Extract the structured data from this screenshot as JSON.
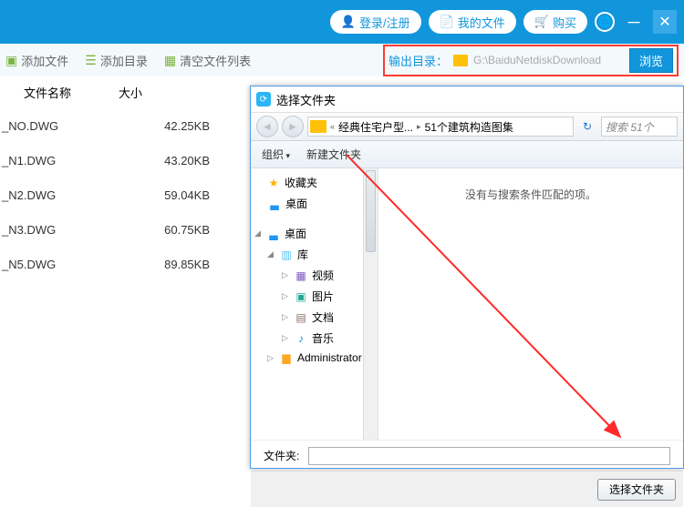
{
  "topbar": {
    "login": "登录/注册",
    "myfiles": "我的文件",
    "buy": "购买"
  },
  "toolbar": {
    "add_file": "添加文件",
    "add_dir": "添加目录",
    "clear": "清空文件列表",
    "output_label": "输出目录：",
    "output_path": "G:\\BaiduNetdiskDownload",
    "browse": "浏览"
  },
  "headers": {
    "name": "文件名称",
    "size": "大小"
  },
  "files": [
    {
      "name": "_NO.DWG",
      "size": "42.25KB"
    },
    {
      "name": "_N1.DWG",
      "size": "43.20KB"
    },
    {
      "name": "_N2.DWG",
      "size": "59.04KB"
    },
    {
      "name": "_N3.DWG",
      "size": "60.75KB"
    },
    {
      "name": "_N5.DWG",
      "size": "89.85KB"
    }
  ],
  "dialog": {
    "title": "选择文件夹",
    "crumb1": "经典住宅户型...",
    "crumb2": "51个建筑构造图集",
    "search_placeholder": "搜索 51个",
    "organize": "组织",
    "new_folder": "新建文件夹",
    "empty_msg": "没有与搜索条件匹配的项。",
    "folder_label": "文件夹:",
    "select_btn": "选择文件夹"
  },
  "tree": {
    "favorites": "收藏夹",
    "desktop": "桌面",
    "desktop2": "桌面",
    "libraries": "库",
    "videos": "视频",
    "pictures": "图片",
    "documents": "文档",
    "music": "音乐",
    "admin": "Administrator"
  }
}
